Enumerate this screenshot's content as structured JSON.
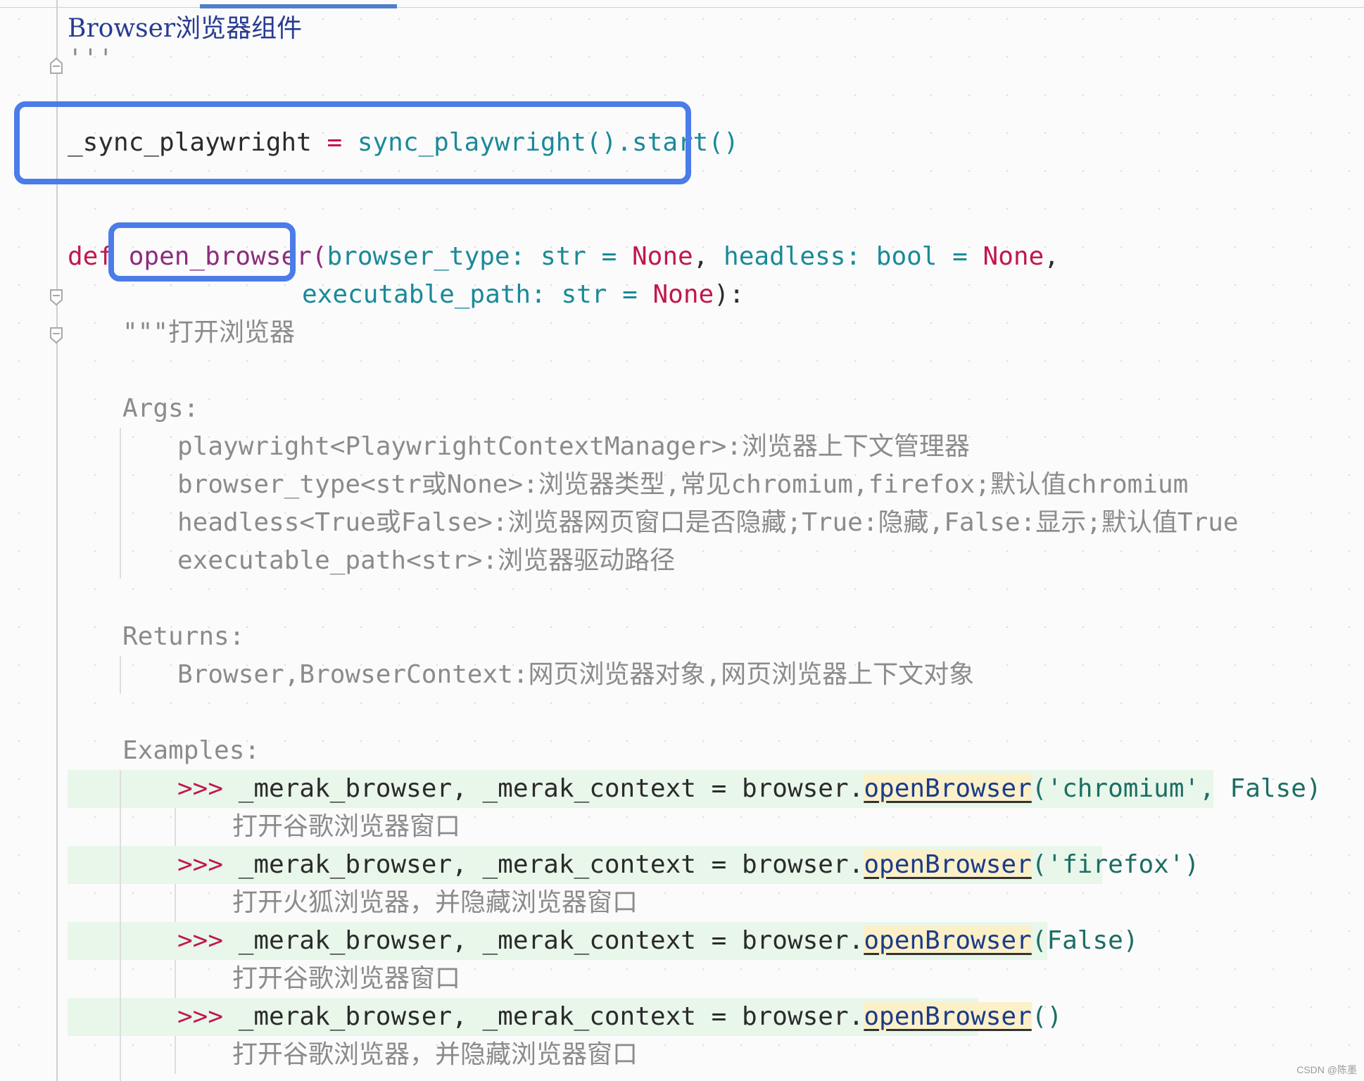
{
  "header": {
    "title": "Browser浏览器组件",
    "doc_close": "'''"
  },
  "assignment": {
    "name": "_sync_playwright",
    "eq": " = ",
    "call": "sync_playwright",
    "paren1": "()",
    "dot": ".",
    "start": "start",
    "paren2": "()"
  },
  "def": {
    "keyword": "def",
    "name": "open_browser",
    "open_paren": "(",
    "p1": "browser_type",
    "p1_rest": ": str = ",
    "none1": "None",
    "comma1": ", ",
    "p2": "headless",
    "p2_rest": ": bool = ",
    "none2": "None",
    "comma2": ",",
    "p3": "executable_path",
    "p3_rest": ": str = ",
    "none3": "None",
    "close": "):"
  },
  "docstring": {
    "open": "\"\"\"打开浏览器",
    "args_label": "Args:",
    "args": [
      "playwright<PlaywrightContextManager>:浏览器上下文管理器",
      "browser_type<str或None>:浏览器类型,常见chromium,firefox;默认值chromium",
      "headless<True或False>:浏览器网页窗口是否隐藏;True:隐藏,False:显示;默认值True",
      "executable_path<str>:浏览器驱动路径"
    ],
    "returns_label": "Returns:",
    "returns": "Browser,BrowserContext:网页浏览器对象,网页浏览器上下文对象",
    "examples_label": "Examples:",
    "examples": [
      {
        "prompt": ">>> ",
        "lhs": "_merak_browser, _merak_context = browser.",
        "method": "openBrowser",
        "args": "('chromium', False)",
        "comment": "打开谷歌浏览器窗口"
      },
      {
        "prompt": ">>> ",
        "lhs": "_merak_browser, _merak_context = browser.",
        "method": "openBrowser",
        "args": "('firefox')",
        "comment": "打开火狐浏览器，并隐藏浏览器窗口"
      },
      {
        "prompt": ">>> ",
        "lhs": "_merak_browser, _merak_context = browser.",
        "method": "openBrowser",
        "args": "(False)",
        "comment": "打开谷歌浏览器窗口"
      },
      {
        "prompt": ">>> ",
        "lhs": "_merak_browser, _merak_context = browser.",
        "method": "openBrowser",
        "args": "()",
        "comment": "打开谷歌浏览器，并隐藏浏览器窗口"
      }
    ]
  },
  "watermark": "CSDN @陈墨",
  "colors": {
    "highlight_box": "#4b7ce8",
    "keyword": "#c1184b",
    "param": "#1a8a99",
    "doctest_row": "#e9f6ea",
    "method_highlight": "#fbf0c7"
  }
}
